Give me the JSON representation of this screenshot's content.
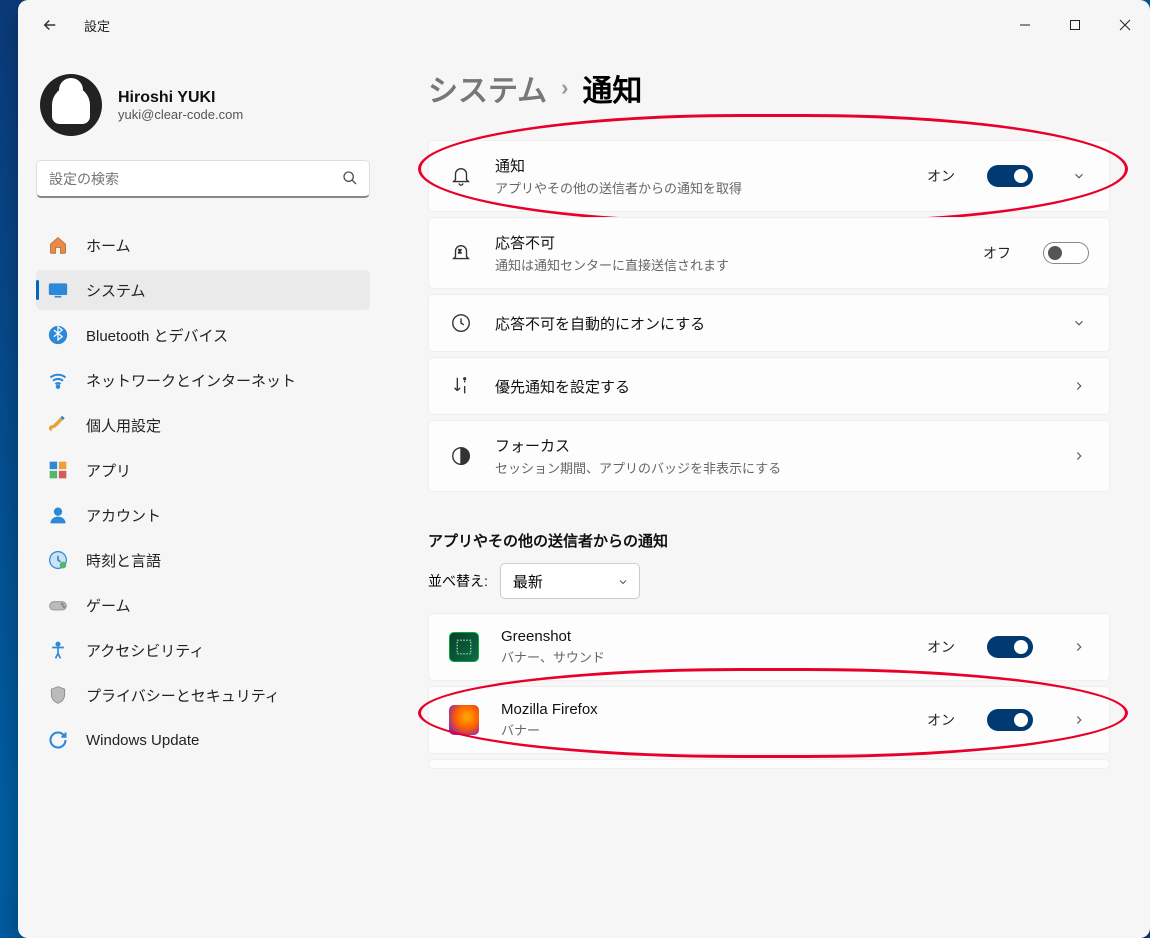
{
  "window": {
    "title": "設定"
  },
  "profile": {
    "name": "Hiroshi YUKI",
    "email": "yuki@clear-code.com"
  },
  "search": {
    "placeholder": "設定の検索"
  },
  "nav": {
    "home": "ホーム",
    "system": "システム",
    "bluetooth": "Bluetooth とデバイス",
    "network": "ネットワークとインターネット",
    "personalization": "個人用設定",
    "apps": "アプリ",
    "accounts": "アカウント",
    "time": "時刻と言語",
    "gaming": "ゲーム",
    "accessibility": "アクセシビリティ",
    "privacy": "プライバシーとセキュリティ",
    "update": "Windows Update"
  },
  "breadcrumb": {
    "parent": "システム",
    "current": "通知"
  },
  "cards": {
    "notifications": {
      "title": "通知",
      "desc": "アプリやその他の送信者からの通知を取得",
      "state": "オン"
    },
    "dnd": {
      "title": "応答不可",
      "desc": "通知は通知センターに直接送信されます",
      "state": "オフ"
    },
    "auto_dnd": {
      "title": "応答不可を自動的にオンにする"
    },
    "priority": {
      "title": "優先通知を設定する"
    },
    "focus": {
      "title": "フォーカス",
      "desc": "セッション期間、アプリのバッジを非表示にする"
    }
  },
  "apps_section": {
    "heading": "アプリやその他の送信者からの通知",
    "sort_label": "並べ替え:",
    "sort_value": "最新",
    "items": [
      {
        "name": "Greenshot",
        "desc": "バナー、サウンド",
        "state": "オン"
      },
      {
        "name": "Mozilla Firefox",
        "desc": "バナー",
        "state": "オン"
      }
    ]
  }
}
